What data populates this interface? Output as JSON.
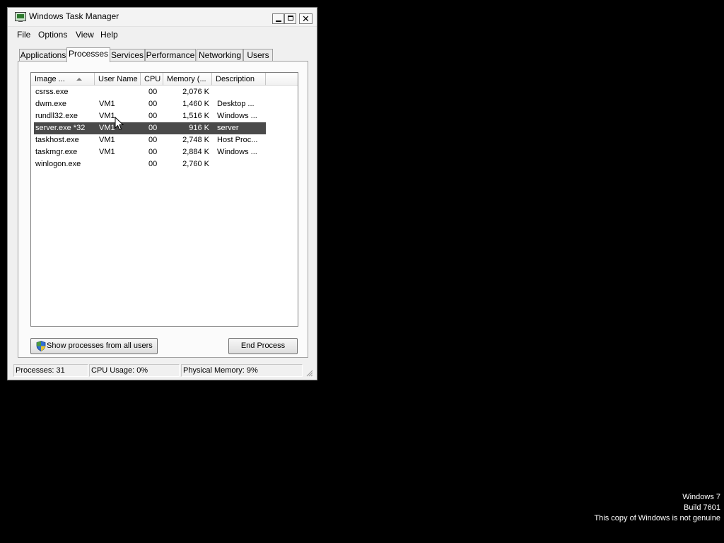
{
  "window": {
    "title": "Windows Task Manager",
    "menu": [
      "File",
      "Options",
      "View",
      "Help"
    ],
    "tabs": [
      "Applications",
      "Processes",
      "Services",
      "Performance",
      "Networking",
      "Users"
    ],
    "active_tab": "Processes"
  },
  "processes": {
    "columns": [
      "Image ...",
      "User Name",
      "CPU",
      "Memory (...",
      "Description"
    ],
    "sort_column": "Image ...",
    "rows": [
      {
        "image": "csrss.exe",
        "user": "",
        "cpu": "00",
        "memory": "2,076 K",
        "description": ""
      },
      {
        "image": "dwm.exe",
        "user": "VM1",
        "cpu": "00",
        "memory": "1,460 K",
        "description": "Desktop ..."
      },
      {
        "image": "rundll32.exe",
        "user": "VM1",
        "cpu": "00",
        "memory": "1,516 K",
        "description": "Windows ..."
      },
      {
        "image": "server.exe *32",
        "user": "VM1",
        "cpu": "00",
        "memory": "916 K",
        "description": "server"
      },
      {
        "image": "taskhost.exe",
        "user": "VM1",
        "cpu": "00",
        "memory": "2,748 K",
        "description": "Host Proc..."
      },
      {
        "image": "taskmgr.exe",
        "user": "VM1",
        "cpu": "00",
        "memory": "2,884 K",
        "description": "Windows ..."
      },
      {
        "image": "winlogon.exe",
        "user": "",
        "cpu": "00",
        "memory": "2,760 K",
        "description": ""
      }
    ],
    "selected_image": "server.exe *32",
    "show_all_button": "Show processes from all users",
    "end_process_button": "End Process"
  },
  "status": {
    "processes": "Processes: 31",
    "cpu": "CPU Usage: 0%",
    "memory": "Physical Memory: 9%"
  },
  "watermark": {
    "line1": "Windows 7",
    "line2": "Build 7601",
    "line3": "This copy of Windows is not genuine"
  },
  "colors": {
    "desktop": "#000000",
    "window_bg": "#f0f0f0",
    "selection": "#4a4a4a"
  }
}
